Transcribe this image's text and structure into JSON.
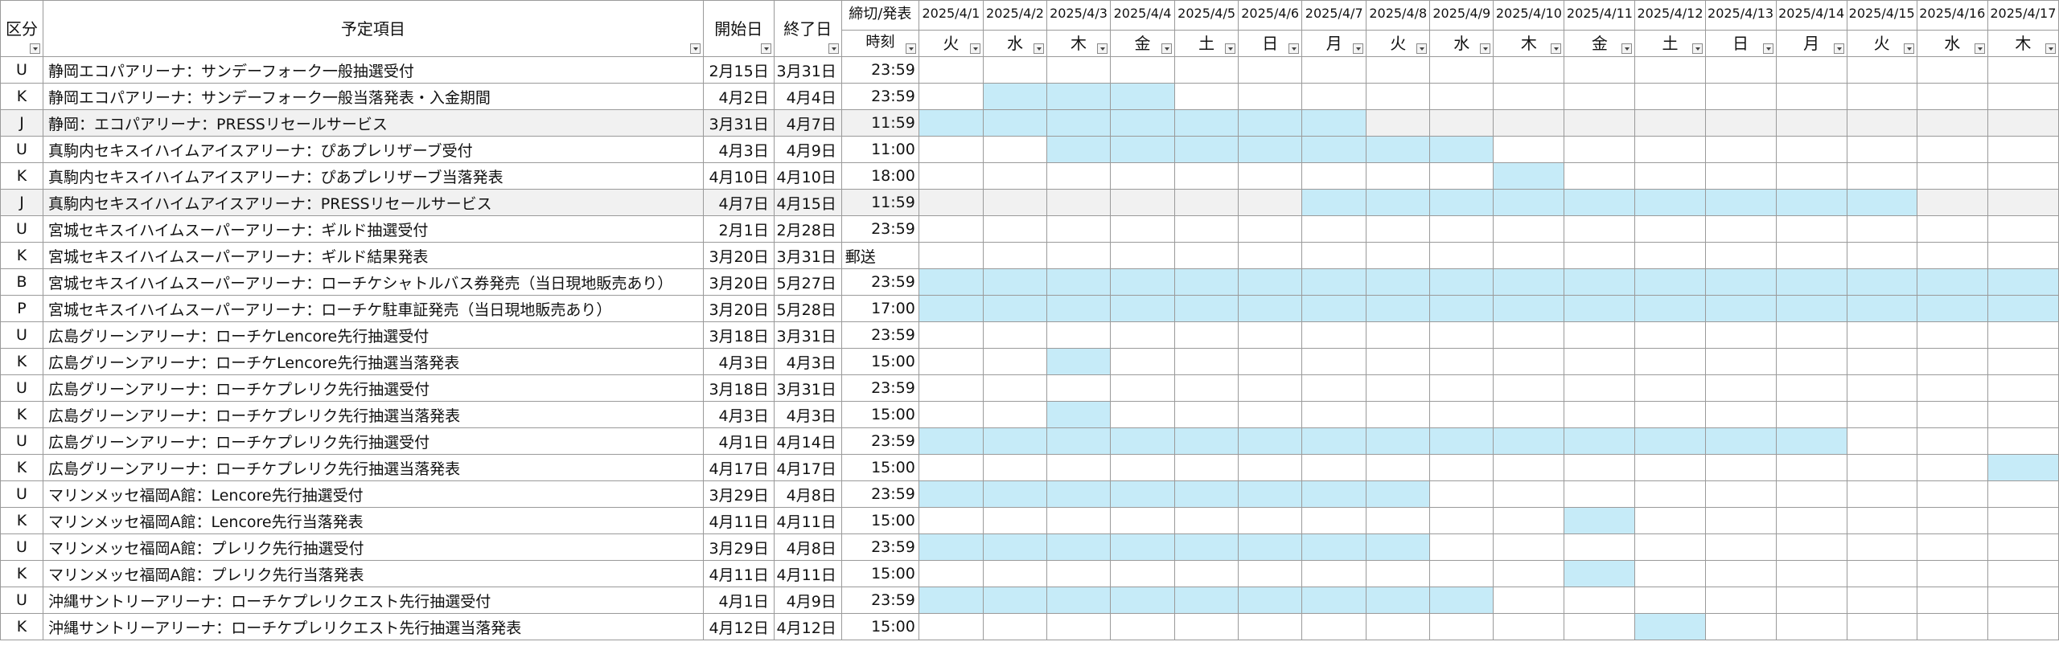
{
  "headers": {
    "category": "区分",
    "item": "予定項目",
    "start": "開始日",
    "end": "終了日",
    "time_top": "締切/発表",
    "time_bottom": "時刻"
  },
  "highlight_color": "#c6ebf8",
  "days": [
    {
      "date": "2025/4/1",
      "dow": "火"
    },
    {
      "date": "2025/4/2",
      "dow": "水"
    },
    {
      "date": "2025/4/3",
      "dow": "木"
    },
    {
      "date": "2025/4/4",
      "dow": "金"
    },
    {
      "date": "2025/4/5",
      "dow": "土"
    },
    {
      "date": "2025/4/6",
      "dow": "日"
    },
    {
      "date": "2025/4/7",
      "dow": "月"
    },
    {
      "date": "2025/4/8",
      "dow": "火"
    },
    {
      "date": "2025/4/9",
      "dow": "水"
    },
    {
      "date": "2025/4/10",
      "dow": "木"
    },
    {
      "date": "2025/4/11",
      "dow": "金"
    },
    {
      "date": "2025/4/12",
      "dow": "土"
    },
    {
      "date": "2025/4/13",
      "dow": "日"
    },
    {
      "date": "2025/4/14",
      "dow": "月"
    },
    {
      "date": "2025/4/15",
      "dow": "火"
    },
    {
      "date": "2025/4/16",
      "dow": "水"
    },
    {
      "date": "2025/4/17",
      "dow": "木"
    }
  ],
  "rows": [
    {
      "cat": "U",
      "item": "静岡エコパアリーナ：サンデーフォーク一般抽選受付",
      "start": "2月15日",
      "end": "3月31日",
      "time": "23:59",
      "hl_from": null,
      "hl_to": null,
      "gray": false
    },
    {
      "cat": "K",
      "item": "静岡エコパアリーナ：サンデーフォーク一般当落発表・入金期間",
      "start": "4月2日",
      "end": "4月4日",
      "time": "23:59",
      "hl_from": 2,
      "hl_to": 4,
      "gray": false
    },
    {
      "cat": "J",
      "item": "静岡：エコパアリーナ：PRESSリセールサービス",
      "start": "3月31日",
      "end": "4月7日",
      "time": "11:59",
      "hl_from": 1,
      "hl_to": 7,
      "gray": true
    },
    {
      "cat": "U",
      "item": "真駒内セキスイハイムアイスアリーナ：ぴあプレリザーブ受付",
      "start": "4月3日",
      "end": "4月9日",
      "time": "11:00",
      "hl_from": 3,
      "hl_to": 9,
      "gray": false
    },
    {
      "cat": "K",
      "item": "真駒内セキスイハイムアイスアリーナ：ぴあプレリザーブ当落発表",
      "start": "4月10日",
      "end": "4月10日",
      "time": "18:00",
      "hl_from": 10,
      "hl_to": 10,
      "gray": false
    },
    {
      "cat": "J",
      "item": "真駒内セキスイハイムアイスアリーナ：PRESSリセールサービス",
      "start": "4月7日",
      "end": "4月15日",
      "time": "11:59",
      "hl_from": 7,
      "hl_to": 15,
      "gray": true
    },
    {
      "cat": "U",
      "item": "宮城セキスイハイムスーパーアリーナ：ギルド抽選受付",
      "start": "2月1日",
      "end": "2月28日",
      "time": "23:59",
      "hl_from": null,
      "hl_to": null,
      "gray": false
    },
    {
      "cat": "K",
      "item": "宮城セキスイハイムスーパーアリーナ：ギルド結果発表",
      "start": "3月20日",
      "end": "3月31日",
      "time": "郵送",
      "hl_from": null,
      "hl_to": null,
      "gray": false
    },
    {
      "cat": "B",
      "item": "宮城セキスイハイムスーパーアリーナ：ローチケシャトルバス券発売（当日現地販売あり）",
      "start": "3月20日",
      "end": "5月27日",
      "time": "23:59",
      "hl_from": 1,
      "hl_to": 17,
      "gray": false
    },
    {
      "cat": "P",
      "item": "宮城セキスイハイムスーパーアリーナ：ローチケ駐車証発売（当日現地販売あり）",
      "start": "3月20日",
      "end": "5月28日",
      "time": "17:00",
      "hl_from": 1,
      "hl_to": 17,
      "gray": false
    },
    {
      "cat": "U",
      "item": "広島グリーンアリーナ：ローチケLencore先行抽選受付",
      "start": "3月18日",
      "end": "3月31日",
      "time": "23:59",
      "hl_from": null,
      "hl_to": null,
      "gray": false
    },
    {
      "cat": "K",
      "item": "広島グリーンアリーナ：ローチケLencore先行抽選当落発表",
      "start": "4月3日",
      "end": "4月3日",
      "time": "15:00",
      "hl_from": 3,
      "hl_to": 3,
      "gray": false
    },
    {
      "cat": "U",
      "item": "広島グリーンアリーナ：ローチケプレリク先行抽選受付",
      "start": "3月18日",
      "end": "3月31日",
      "time": "23:59",
      "hl_from": null,
      "hl_to": null,
      "gray": false
    },
    {
      "cat": "K",
      "item": "広島グリーンアリーナ：ローチケプレリク先行抽選当落発表",
      "start": "4月3日",
      "end": "4月3日",
      "time": "15:00",
      "hl_from": 3,
      "hl_to": 3,
      "gray": false
    },
    {
      "cat": "U",
      "item": "広島グリーンアリーナ：ローチケプレリク先行抽選受付",
      "start": "4月1日",
      "end": "4月14日",
      "time": "23:59",
      "hl_from": 1,
      "hl_to": 14,
      "gray": false
    },
    {
      "cat": "K",
      "item": "広島グリーンアリーナ：ローチケプレリク先行抽選当落発表",
      "start": "4月17日",
      "end": "4月17日",
      "time": "15:00",
      "hl_from": 17,
      "hl_to": 17,
      "gray": false
    },
    {
      "cat": "U",
      "item": "マリンメッセ福岡A館：Lencore先行抽選受付",
      "start": "3月29日",
      "end": "4月8日",
      "time": "23:59",
      "hl_from": 1,
      "hl_to": 8,
      "gray": false
    },
    {
      "cat": "K",
      "item": "マリンメッセ福岡A館：Lencore先行当落発表",
      "start": "4月11日",
      "end": "4月11日",
      "time": "15:00",
      "hl_from": 11,
      "hl_to": 11,
      "gray": false
    },
    {
      "cat": "U",
      "item": "マリンメッセ福岡A館：プレリク先行抽選受付",
      "start": "3月29日",
      "end": "4月8日",
      "time": "23:59",
      "hl_from": 1,
      "hl_to": 8,
      "gray": false
    },
    {
      "cat": "K",
      "item": "マリンメッセ福岡A館：プレリク先行当落発表",
      "start": "4月11日",
      "end": "4月11日",
      "time": "15:00",
      "hl_from": 11,
      "hl_to": 11,
      "gray": false
    },
    {
      "cat": "U",
      "item": "沖縄サントリーアリーナ：ローチケプレリクエスト先行抽選受付",
      "start": "4月1日",
      "end": "4月9日",
      "time": "23:59",
      "hl_from": 1,
      "hl_to": 9,
      "gray": false
    },
    {
      "cat": "K",
      "item": "沖縄サントリーアリーナ：ローチケプレリクエスト先行抽選当落発表",
      "start": "4月12日",
      "end": "4月12日",
      "time": "15:00",
      "hl_from": 12,
      "hl_to": 12,
      "gray": false
    }
  ]
}
